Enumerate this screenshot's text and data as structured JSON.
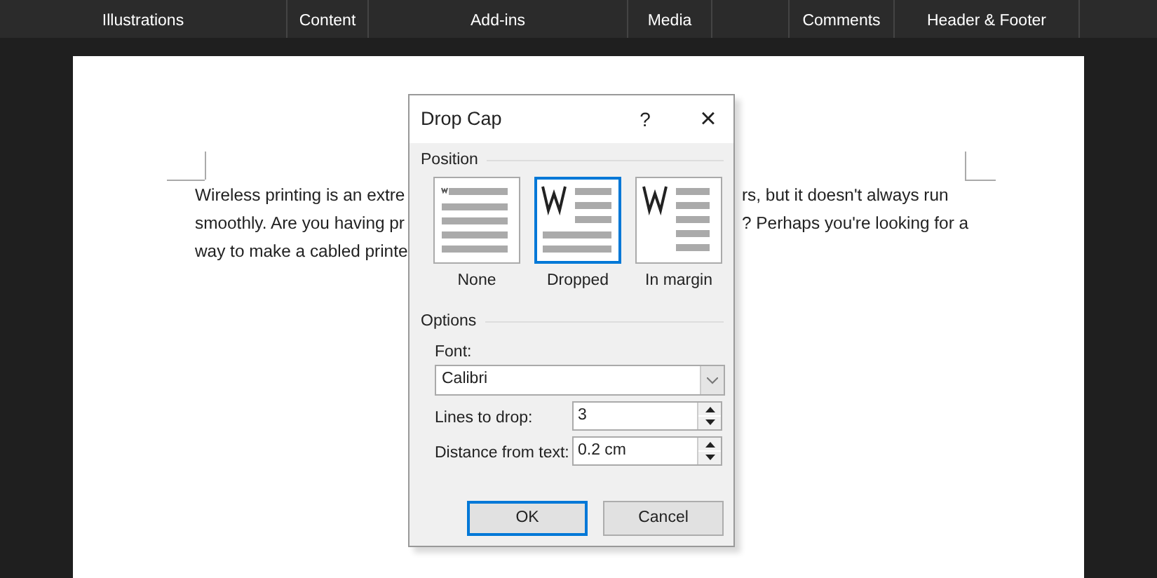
{
  "ribbon": {
    "groups": [
      {
        "label": "Illustrations"
      },
      {
        "label": "Content"
      },
      {
        "label": "Add-ins"
      },
      {
        "label": "Media"
      },
      {
        "label": "Comments"
      },
      {
        "label": "Header & Footer"
      }
    ]
  },
  "document": {
    "lines": [
      {
        "left": "Wireless printing is an extre",
        "right": "rs, but it doesn't always run"
      },
      {
        "left": "smoothly. Are you having pr",
        "right": "? Perhaps you're looking for a"
      },
      {
        "left": "way to make a cabled printe"
      }
    ]
  },
  "dialog": {
    "title": "Drop Cap",
    "help": "?",
    "close": "×",
    "position_label": "Position",
    "positions": [
      {
        "kind": "none",
        "label": "None",
        "selected": false
      },
      {
        "kind": "dropped",
        "label": "Dropped",
        "selected": true
      },
      {
        "kind": "margin",
        "label": "In margin",
        "selected": false
      }
    ],
    "options_label": "Options",
    "font_label": "Font:",
    "font_value": "Calibri",
    "lines_label": "Lines to drop:",
    "lines_value": "3",
    "distance_label": "Distance from text:",
    "distance_value": "0.2 cm",
    "buttons": [
      {
        "label": "OK",
        "default": true
      },
      {
        "label": "Cancel",
        "default": false
      }
    ]
  }
}
